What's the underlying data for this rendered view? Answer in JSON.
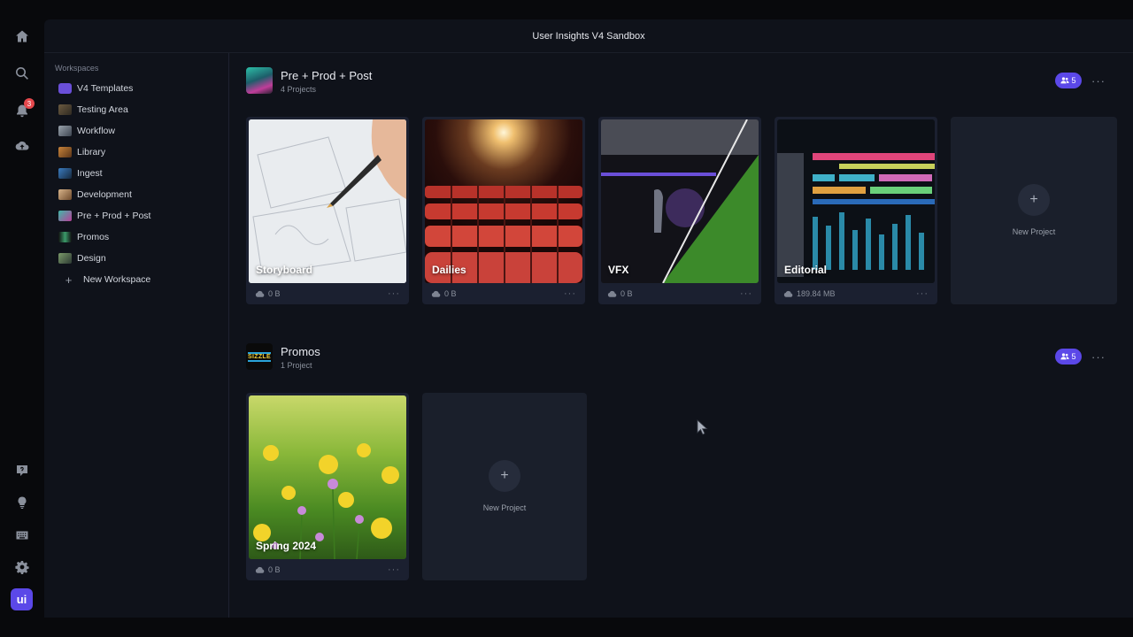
{
  "app": {
    "title": "User Insights V4 Sandbox",
    "brand_label": "ui"
  },
  "rail": {
    "items": [
      {
        "icon": "home-icon"
      },
      {
        "icon": "search-icon"
      },
      {
        "icon": "bell-icon",
        "badge": "3"
      },
      {
        "icon": "cloud-upload-icon"
      },
      {
        "icon": "help-icon"
      },
      {
        "icon": "lightbulb-icon"
      },
      {
        "icon": "keyboard-icon"
      },
      {
        "icon": "gear-icon"
      }
    ]
  },
  "sidebar": {
    "heading": "Workspaces",
    "items": [
      {
        "label": "V4 Templates"
      },
      {
        "label": "Testing Area"
      },
      {
        "label": "Workflow"
      },
      {
        "label": "Library"
      },
      {
        "label": "Ingest"
      },
      {
        "label": "Development"
      },
      {
        "label": "Pre + Prod + Post"
      },
      {
        "label": "Promos"
      },
      {
        "label": "Design"
      }
    ],
    "new_workspace": "New Workspace"
  },
  "sections": [
    {
      "title": "Pre + Prod + Post",
      "subtitle": "4 Projects",
      "members": "5",
      "projects": [
        {
          "name": "Storyboard",
          "size": "0 B"
        },
        {
          "name": "Dailies",
          "size": "0 B"
        },
        {
          "name": "VFX",
          "size": "0 B"
        },
        {
          "name": "Editorial",
          "size": "189.84 MB"
        }
      ],
      "new_project": "New Project"
    },
    {
      "title": "Promos",
      "subtitle": "1 Project",
      "thumb_text": "SIZZLE",
      "members": "5",
      "projects": [
        {
          "name": "Spring 2024",
          "size": "0 B"
        }
      ],
      "new_project": "New Project"
    }
  ],
  "colors": {
    "accent": "#5b48e8",
    "background": "#0f121a",
    "card": "#1b2030"
  }
}
